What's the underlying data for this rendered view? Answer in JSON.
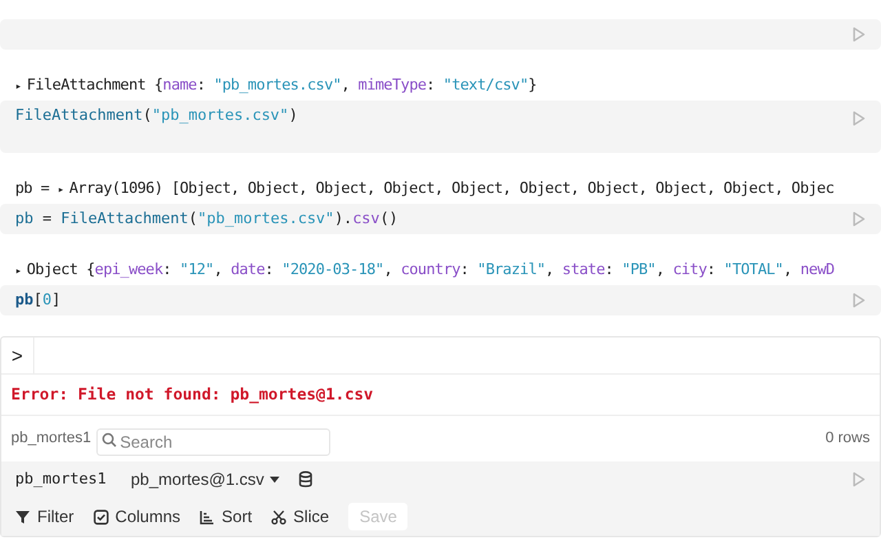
{
  "cells": [
    {},
    {
      "output": [
        {
          "kind": "toggle",
          "text": "▸"
        },
        {
          "kind": "plain",
          "text": "FileAttachment {"
        },
        {
          "kind": "key",
          "text": "name"
        },
        {
          "kind": "plain",
          "text": ": "
        },
        {
          "kind": "string",
          "text": "\"pb_mortes.csv\""
        },
        {
          "kind": "plain",
          "text": ", "
        },
        {
          "kind": "key",
          "text": "mimeType"
        },
        {
          "kind": "plain",
          "text": ": "
        },
        {
          "kind": "string",
          "text": "\"text/csv\""
        },
        {
          "kind": "plain",
          "text": "}"
        }
      ],
      "code": [
        {
          "kind": "func",
          "text": "FileAttachment"
        },
        {
          "kind": "plain",
          "text": "("
        },
        {
          "kind": "string",
          "text": "\"pb_mortes.csv\""
        },
        {
          "kind": "plain",
          "text": ")"
        }
      ]
    },
    {
      "output": [
        {
          "kind": "plain",
          "text": "pb = "
        },
        {
          "kind": "toggle",
          "text": "▸"
        },
        {
          "kind": "plain",
          "text": "Array(1096) [Object, Object, Object, Object, Object, Object, Object, Object, Object, Objec"
        }
      ],
      "code": [
        {
          "kind": "func",
          "text": "pb"
        },
        {
          "kind": "plain",
          "text": " = "
        },
        {
          "kind": "func",
          "text": "FileAttachment"
        },
        {
          "kind": "plain",
          "text": "("
        },
        {
          "kind": "string",
          "text": "\"pb_mortes.csv\""
        },
        {
          "kind": "plain",
          "text": ")."
        },
        {
          "kind": "key",
          "text": "csv"
        },
        {
          "kind": "plain",
          "text": "()"
        }
      ]
    },
    {
      "output": [
        {
          "kind": "toggle",
          "text": "▸"
        },
        {
          "kind": "plain",
          "text": "Object {"
        },
        {
          "kind": "key",
          "text": "epi_week"
        },
        {
          "kind": "plain",
          "text": ": "
        },
        {
          "kind": "string",
          "text": "\"12\""
        },
        {
          "kind": "plain",
          "text": ", "
        },
        {
          "kind": "key",
          "text": "date"
        },
        {
          "kind": "plain",
          "text": ": "
        },
        {
          "kind": "string",
          "text": "\"2020-03-18\""
        },
        {
          "kind": "plain",
          "text": ", "
        },
        {
          "kind": "key",
          "text": "country"
        },
        {
          "kind": "plain",
          "text": ": "
        },
        {
          "kind": "string",
          "text": "\"Brazil\""
        },
        {
          "kind": "plain",
          "text": ", "
        },
        {
          "kind": "key",
          "text": "state"
        },
        {
          "kind": "plain",
          "text": ": "
        },
        {
          "kind": "string",
          "text": "\"PB\""
        },
        {
          "kind": "plain",
          "text": ", "
        },
        {
          "kind": "key",
          "text": "city"
        },
        {
          "kind": "plain",
          "text": ": "
        },
        {
          "kind": "string",
          "text": "\"TOTAL\""
        },
        {
          "kind": "plain",
          "text": ", "
        },
        {
          "kind": "key",
          "text": "newD"
        }
      ],
      "code": [
        {
          "kind": "ref",
          "text": "pb"
        },
        {
          "kind": "plain",
          "text": "["
        },
        {
          "kind": "number",
          "text": "0"
        },
        {
          "kind": "plain",
          "text": "]"
        }
      ]
    }
  ],
  "table_cell": {
    "prompt": ">",
    "error": "Error: File not found: pb_mortes@1.csv",
    "table_name": "pb_mortes1",
    "search": {
      "placeholder": "Search"
    },
    "row_count": "0 rows",
    "source": {
      "name": "pb_mortes1",
      "file": "pb_mortes@1.csv"
    },
    "toolbar": [
      {
        "kind": "filter",
        "label": "Filter",
        "disabled": false
      },
      {
        "kind": "columns",
        "label": "Columns",
        "disabled": false
      },
      {
        "kind": "sort",
        "label": "Sort",
        "disabled": false
      },
      {
        "kind": "slice",
        "label": "Slice",
        "disabled": false
      },
      {
        "kind": "save",
        "label": "Save",
        "disabled": true
      }
    ]
  }
}
